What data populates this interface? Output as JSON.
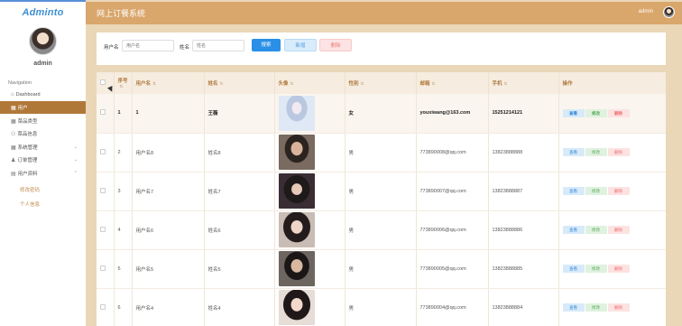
{
  "sidebar": {
    "logo": "Adminto",
    "username": "admin",
    "nav_title": "Navigation",
    "items": [
      {
        "label": "Dashboard",
        "icon": "home-icon"
      },
      {
        "label": "用户",
        "icon": "grid-icon"
      },
      {
        "label": "菜品类型",
        "icon": "grid-icon"
      },
      {
        "label": "菜品信息",
        "icon": "graph-icon"
      },
      {
        "label": "系统管理",
        "icon": "grid-icon"
      },
      {
        "label": "订单管理",
        "icon": "user-icon"
      },
      {
        "label": "用户资料",
        "icon": "doc-icon"
      }
    ],
    "sub_items": [
      "修改密码",
      "个人信息"
    ]
  },
  "header": {
    "title": "网上订餐系统",
    "user": "admin"
  },
  "search": {
    "username_label": "用户名",
    "username_placeholder": "用户名",
    "name_label": "姓名",
    "name_placeholder": "姓名",
    "search_button": "搜索",
    "add_button": "新增",
    "delete_button": "删除"
  },
  "table": {
    "columns": [
      "序号",
      "用户名",
      "姓名",
      "头像",
      "性别",
      "邮箱",
      "手机",
      "操作"
    ],
    "rows": [
      {
        "id": "1",
        "username": "1",
        "name": "王薇",
        "gender": "女",
        "email": "youxiwang@163.com",
        "phone": "15251214121",
        "photo": "anime-girl-avatar"
      },
      {
        "id": "2",
        "username": "用户名8",
        "name": "姓名8",
        "gender": "男",
        "email": "773890008@qq.com",
        "phone": "13823888888",
        "photo": "person-photo"
      },
      {
        "id": "3",
        "username": "用户名7",
        "name": "姓名7",
        "gender": "男",
        "email": "773890007@qq.com",
        "phone": "13823888887",
        "photo": "person-photo"
      },
      {
        "id": "4",
        "username": "用户名6",
        "name": "姓名6",
        "gender": "男",
        "email": "773890006@qq.com",
        "phone": "13823888886",
        "photo": "person-photo"
      },
      {
        "id": "5",
        "username": "用户名5",
        "name": "姓名5",
        "gender": "男",
        "email": "773890005@qq.com",
        "phone": "13823888885",
        "photo": "person-photo"
      },
      {
        "id": "6",
        "username": "用户名4",
        "name": "姓名4",
        "gender": "男",
        "email": "773890004@qq.com",
        "phone": "13823888884",
        "photo": "person-photo"
      }
    ],
    "actions": {
      "view": "查看",
      "edit": "修改",
      "delete": "删除"
    }
  },
  "colors": {
    "header_bg": "#d9a66b",
    "page_bg": "#ead7b8",
    "active_nav": "#b07838",
    "primary": "#2a8fe6"
  }
}
